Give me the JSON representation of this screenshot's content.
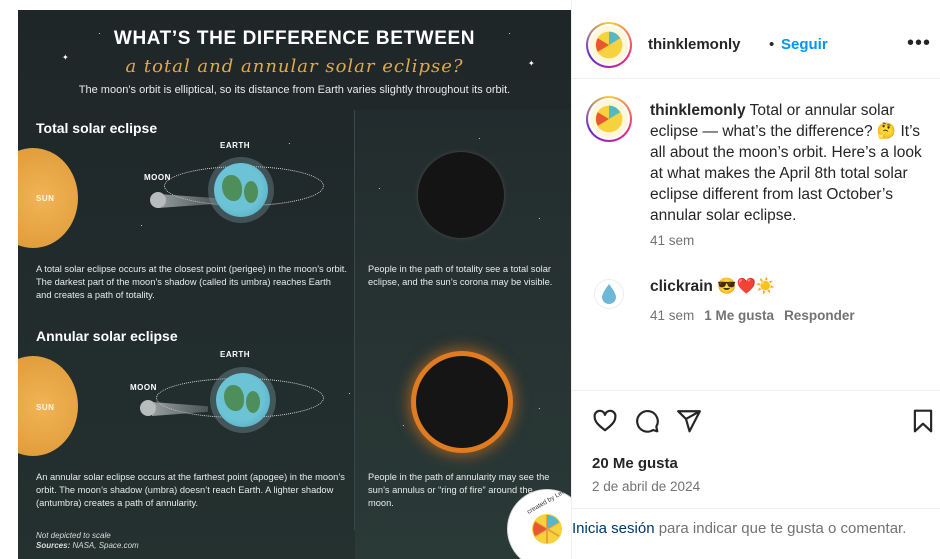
{
  "infographic": {
    "title": "WHAT’S THE DIFFERENCE BETWEEN",
    "subtitle": "a total and annular solar eclipse?",
    "intro": "The moon’s orbit is elliptical, so its distance from Earth varies slightly throughout its orbit.",
    "total": {
      "heading": "Total solar eclipse",
      "sun": "SUN",
      "moon": "MOON",
      "earth": "EARTH",
      "desc_left": "A total solar eclipse occurs at the closest point (perigee) in the moon’s orbit.  The darkest part of the moon’s shadow (called its umbra) reaches Earth and creates a path of totality.",
      "desc_right": "People in the path of totality see a total solar eclipse, and the sun’s corona may be visible."
    },
    "annular": {
      "heading": "Annular solar eclipse",
      "sun": "SUN",
      "moon": "MOON",
      "earth": "EARTH",
      "desc_left": "An annular solar eclipse occurs at the farthest point (apogee) in the moon’s orbit. The moon’s shadow (umbra) doesn’t reach Earth. A lighter shadow (antumbra) creates a path of annularity.",
      "desc_right": "People in the path of annularity may see the sun’s annulus or “ring of fire” around the moon."
    },
    "note_scale": "Not depicted to scale",
    "note_sources_label": "Sources:",
    "note_sources": "NASA, Space.com",
    "badge_credit": "created by Lemonly"
  },
  "post": {
    "username": "thinklemonly",
    "separator": "•",
    "follow_label": "Seguir",
    "more_label": "•••",
    "caption_user": "thinklemonly",
    "caption_text": " Total or annular solar eclipse — what’s the difference? 🤔 It’s all about the moon’s orbit. Here’s a look at what makes the April 8th total solar eclipse different from last October’s annular solar eclipse.",
    "caption_time": "41 sem"
  },
  "comment": {
    "user": "clickrain",
    "emoji": "😎❤️☀️",
    "time": "41 sem",
    "likes": "1 Me gusta",
    "reply": "Responder"
  },
  "actions": {
    "icons": [
      "heart-icon",
      "comment-icon",
      "share-icon",
      "bookmark-icon"
    ]
  },
  "stats": {
    "likes": "20 Me gusta",
    "date": "2 de abril de 2024"
  },
  "login": {
    "link": "Inicia sesión",
    "rest": " para indicar que te gusta o comentar."
  },
  "colors": {
    "accent": "#0095f6",
    "sun": "#e29d3b",
    "ring": "#e07b1f",
    "link_dark": "#00376b"
  }
}
